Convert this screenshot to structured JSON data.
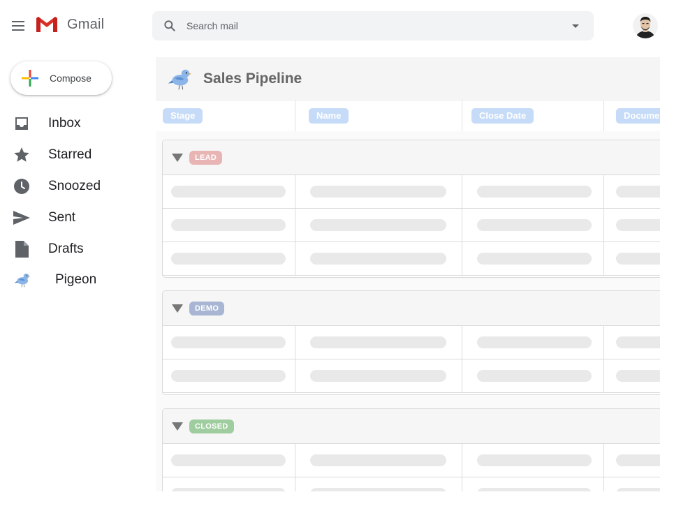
{
  "app": {
    "name": "Gmail",
    "search_placeholder": "Search mail"
  },
  "sidebar": {
    "compose_label": "Compose",
    "items": [
      {
        "label": "Inbox",
        "icon": "inbox-icon"
      },
      {
        "label": "Starred",
        "icon": "star-icon"
      },
      {
        "label": "Snoozed",
        "icon": "clock-icon"
      },
      {
        "label": "Sent",
        "icon": "send-icon"
      },
      {
        "label": "Drafts",
        "icon": "drafts-icon"
      },
      {
        "label": "Pigeon",
        "icon": "pigeon-icon"
      }
    ]
  },
  "pipeline": {
    "title": "Sales Pipeline",
    "columns": [
      "Stage",
      "Name",
      "Close Date",
      "Documents"
    ],
    "groups": [
      {
        "label": "LEAD",
        "color": "#e8b4b4",
        "rows": 3
      },
      {
        "label": "DEMO",
        "color": "#a9b6d3",
        "rows": 2
      },
      {
        "label": "CLOSED",
        "color": "#9fcd9f",
        "rows": 2
      }
    ]
  },
  "colors": {
    "chip": "#c6dbf7",
    "placeholder": "#e9e9e9"
  }
}
